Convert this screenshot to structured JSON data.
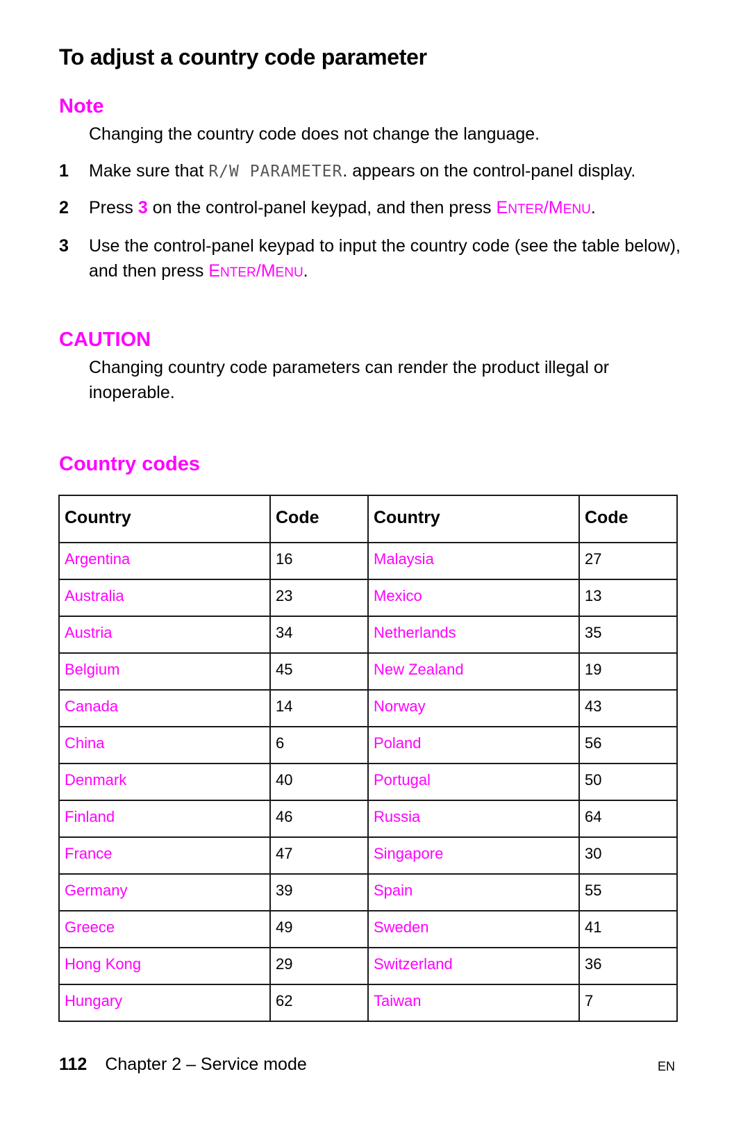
{
  "page": {
    "title": "To adjust a country code parameter",
    "accent_color": "#ff00ff"
  },
  "note": {
    "heading": "Note",
    "text": "Changing the country code does not change the language."
  },
  "steps": [
    {
      "number": "1",
      "text_before": "Make sure that ",
      "display_text": "R/W PARAMETER",
      "text_after": ". appears on the control-panel display."
    },
    {
      "number": "2",
      "text_before": "Press ",
      "key": "3",
      "text_middle": " on the control-panel keypad, and then press ",
      "button": {
        "e": "E",
        "nter": "NTER",
        "slash": "/",
        "m": "M",
        "enu": "ENU"
      },
      "text_after": "."
    },
    {
      "number": "3",
      "text_before": "Use the control-panel keypad to input the country code (see the table  below), and then press ",
      "button": {
        "e": "E",
        "nter": "NTER",
        "slash": "/",
        "m": "M",
        "enu": "ENU"
      },
      "text_after": "."
    }
  ],
  "caution": {
    "heading": "CAUTION",
    "text": "Changing country code parameters can render the product illegal or inoperable."
  },
  "country_codes": {
    "heading": "Country codes",
    "headers": [
      "Country",
      "Code",
      "Country",
      "Code"
    ],
    "rows": [
      [
        "Argentina",
        "16",
        "Malaysia",
        "27"
      ],
      [
        "Australia",
        "23",
        "Mexico",
        "13"
      ],
      [
        "Austria",
        "34",
        "Netherlands",
        "35"
      ],
      [
        "Belgium",
        "45",
        "New Zealand",
        "19"
      ],
      [
        "Canada",
        "14",
        "Norway",
        "43"
      ],
      [
        "China",
        "6",
        "Poland",
        "56"
      ],
      [
        "Denmark",
        "40",
        "Portugal",
        "50"
      ],
      [
        "Finland",
        "46",
        "Russia",
        "64"
      ],
      [
        "France",
        "47",
        "Singapore",
        "30"
      ],
      [
        "Germany",
        "39",
        "Spain",
        "55"
      ],
      [
        "Greece",
        "49",
        "Sweden",
        "41"
      ],
      [
        "Hong Kong",
        "29",
        "Switzerland",
        "36"
      ],
      [
        "Hungary",
        "62",
        "Taiwan",
        "7"
      ]
    ]
  },
  "footer": {
    "page_number": "112",
    "chapter": "Chapter 2 –  Service mode",
    "language": "EN"
  }
}
